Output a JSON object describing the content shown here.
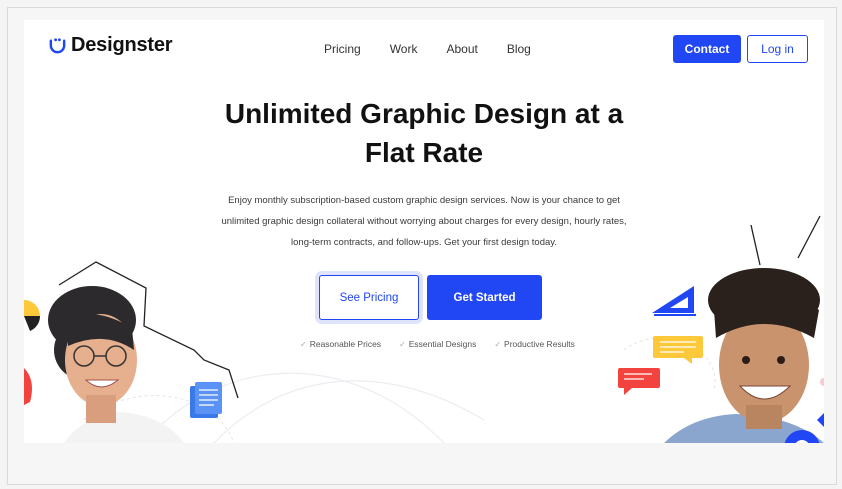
{
  "brand": {
    "name": "Designster",
    "color": "#2146f4"
  },
  "nav": {
    "items": [
      "Pricing",
      "Work",
      "About",
      "Blog"
    ]
  },
  "header": {
    "contact_label": "Contact",
    "login_label": "Log in"
  },
  "hero": {
    "title": "Unlimited Graphic Design at a Flat Rate",
    "title_line1": "Unlimited Graphic Design at a",
    "title_line2": "Flat Rate",
    "subtitle_line1": "Enjoy monthly subscription-based custom graphic design services. Now is your chance to get",
    "subtitle_line2": "unlimited graphic design collateral without worrying about charges for every design, hourly rates,",
    "subtitle_line3": "long-term contracts, and follow-ups. Get your first design today.",
    "see_pricing_label": "See Pricing",
    "get_started_label": "Get Started",
    "features": [
      "Reasonable Prices",
      "Essential Designs",
      "Productive Results"
    ]
  },
  "icons": {
    "logo": "smile-icon",
    "check": "check-icon",
    "document": "document-icon",
    "triangle_ruler": "triangle-ruler-icon",
    "chat_yellow": "chat-bubble-icon",
    "chat_red": "chat-bubble-icon"
  },
  "colors": {
    "primary": "#2146f4",
    "text": "#111111",
    "yellow": "#fdc83a",
    "red": "#f2433f"
  }
}
